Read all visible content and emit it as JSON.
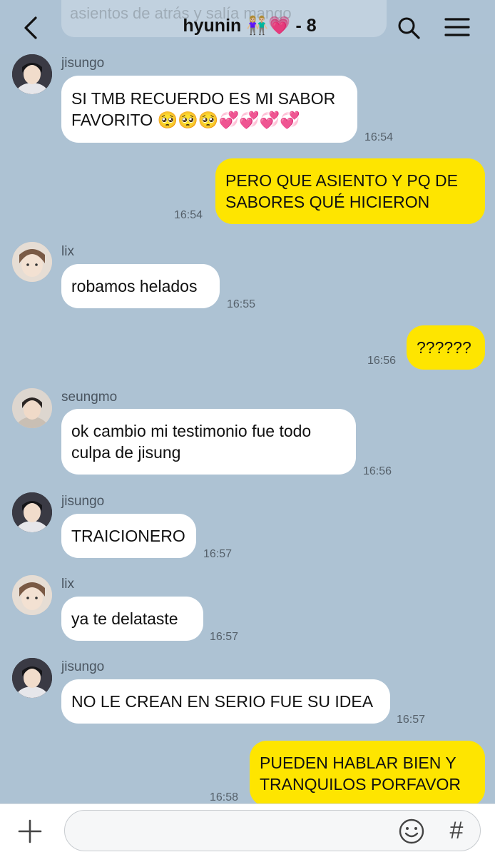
{
  "header": {
    "title": "hyunin 👫🏼💗 - 8",
    "back_icon": "chevron-left-icon",
    "search_icon": "search-icon",
    "menu_icon": "hamburger-menu-icon",
    "partial_previous_message": "asientos de atrás y salía mango"
  },
  "messages": [
    {
      "sender": "jisungo",
      "lines": [
        "SI TMB RECUERDO ES MI SABOR",
        "FAVORITO 🥺🥺🥺💞💞💞💞"
      ],
      "time": "16:54",
      "outgoing": false
    },
    {
      "sender": "",
      "lines": [
        "PERO QUE ASIENTO Y PQ DE",
        "SABORES QUÉ HICIERON"
      ],
      "time": "16:54",
      "outgoing": true
    },
    {
      "sender": "lix",
      "lines": [
        "robamos helados"
      ],
      "time": "16:55",
      "outgoing": false
    },
    {
      "sender": "",
      "lines": [
        "??????"
      ],
      "time": "16:56",
      "outgoing": true
    },
    {
      "sender": "seungmo",
      "lines": [
        "ok cambio mi testimonio fue todo",
        "culpa de jisung"
      ],
      "time": "16:56",
      "outgoing": false
    },
    {
      "sender": "jisungo",
      "lines": [
        "TRAICIONERO"
      ],
      "time": "16:57",
      "outgoing": false
    },
    {
      "sender": "lix",
      "lines": [
        "ya te delataste"
      ],
      "time": "16:57",
      "outgoing": false
    },
    {
      "sender": "jisungo",
      "lines": [
        "NO LE CREAN EN SERIO FUE SU IDEA"
      ],
      "time": "16:57",
      "outgoing": false
    },
    {
      "sender": "",
      "lines": [
        "PUEDEN HABLAR BIEN Y",
        "TRANQUILOS PORFAVOR"
      ],
      "time": "16:58",
      "outgoing": true
    }
  ],
  "composer": {
    "value": "",
    "placeholder": "",
    "plus_icon": "plus-icon",
    "emoji_icon": "emoji-icon",
    "hashtag_label": "#"
  },
  "colors": {
    "background": "#adc2d3",
    "incoming_bubble": "#ffffff",
    "outgoing_bubble": "#fee500"
  }
}
